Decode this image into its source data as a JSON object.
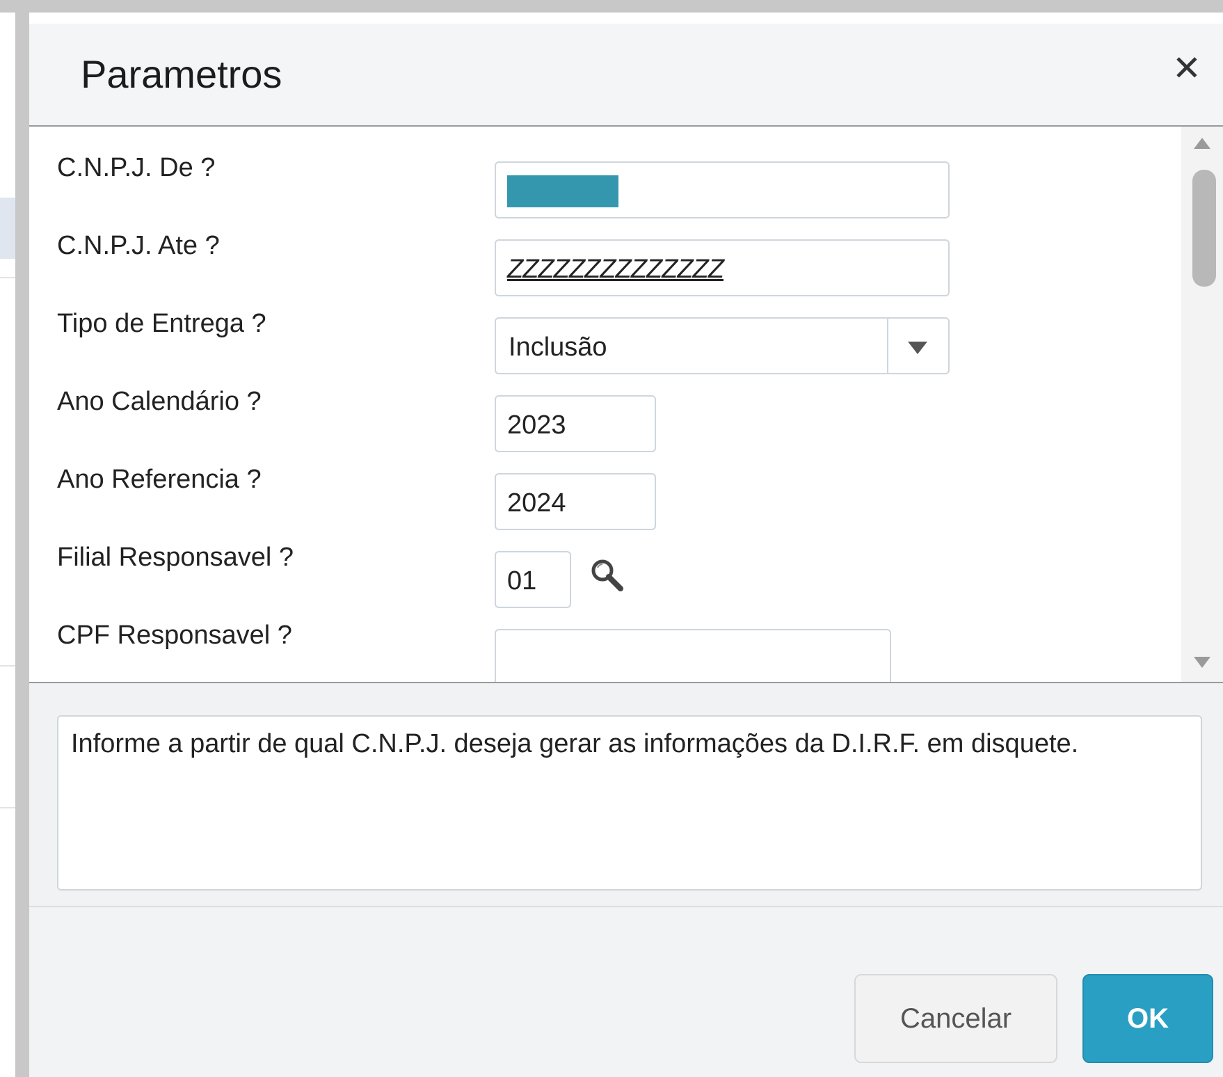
{
  "dialog": {
    "title": "Parametros",
    "close_glyph": "✕"
  },
  "params": [
    {
      "label": "C.N.P.J. De ?",
      "value": "",
      "type": "text"
    },
    {
      "label": "C.N.P.J. Ate ?",
      "value": "ZZZZZZZZZZZZZZ",
      "type": "text"
    },
    {
      "label": "Tipo de Entrega ?",
      "value": "Inclusão",
      "type": "select"
    },
    {
      "label": "Ano Calendário ?",
      "value": "2023",
      "type": "text"
    },
    {
      "label": "Ano Referencia ?",
      "value": "2024",
      "type": "text"
    },
    {
      "label": "Filial Responsavel ?",
      "value": "01",
      "type": "lookup"
    }
  ],
  "next_row_label": "CPF Responsavel ?",
  "help_text": "Informe a partir de qual C.N.P.J. deseja gerar as informações da D.I.R.F. em disquete.",
  "buttons": {
    "cancel": "Cancelar",
    "ok": "OK"
  },
  "colors": {
    "ok_button": "#2a9fc4",
    "selection_highlight": "#3597ad"
  }
}
